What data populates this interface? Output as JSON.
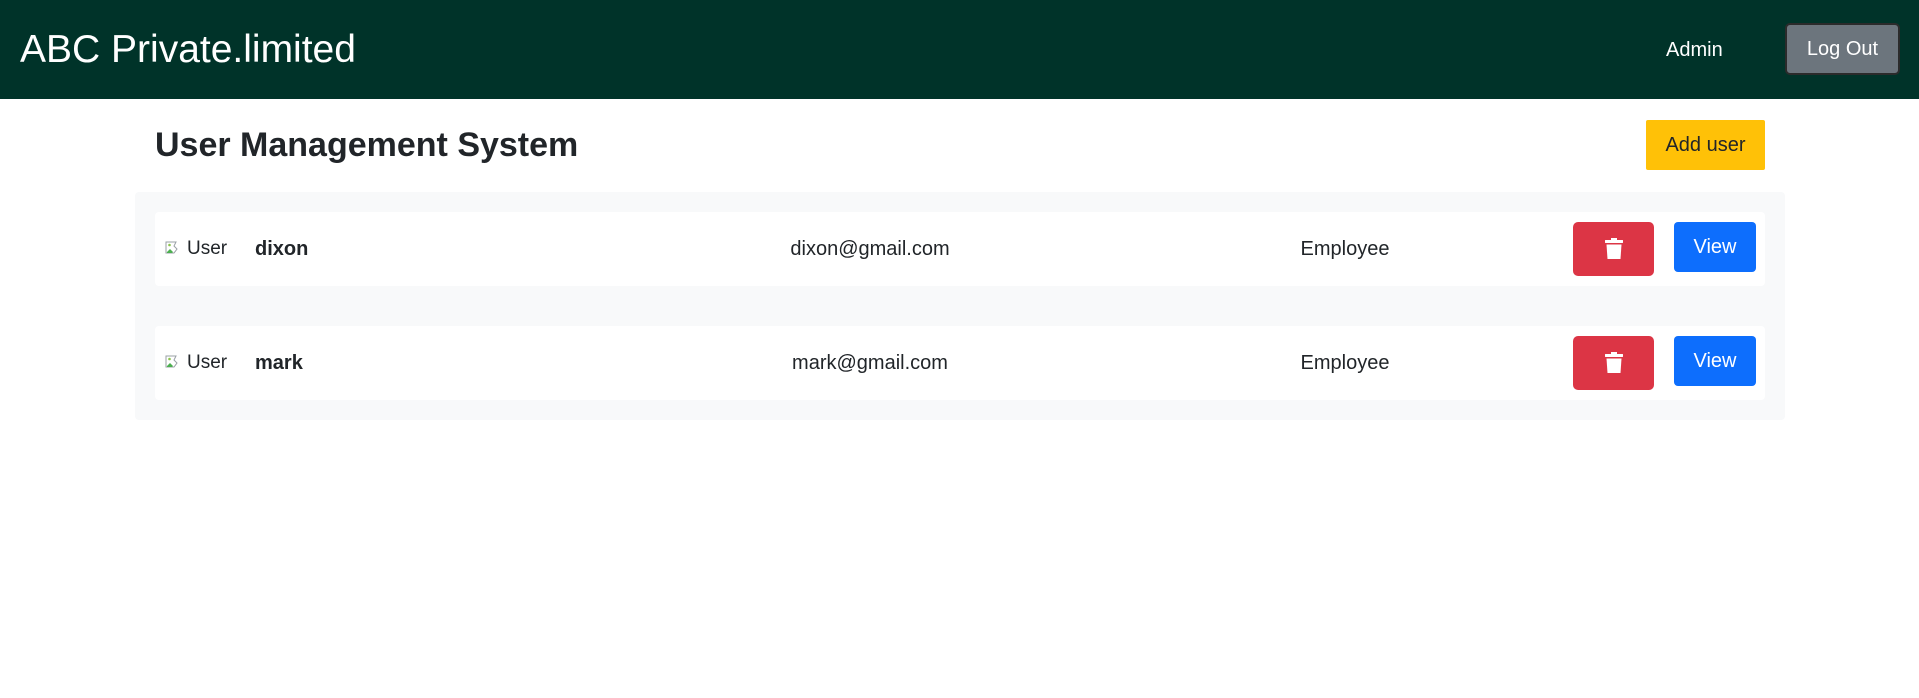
{
  "navbar": {
    "brand": "ABC Private.limited",
    "admin_label": "Admin",
    "logout_label": "Log Out",
    "background_color": "#003329"
  },
  "header": {
    "title": "User Management System",
    "add_user_label": "Add user",
    "add_user_color": "#ffc107"
  },
  "users": [
    {
      "avatar_alt": "User",
      "name": "dixon",
      "email": "dixon@gmail.com",
      "role": "Employee",
      "delete_icon": "trash-icon",
      "view_label": "View"
    },
    {
      "avatar_alt": "User",
      "name": "mark",
      "email": "mark@gmail.com",
      "role": "Employee",
      "delete_icon": "trash-icon",
      "view_label": "View"
    }
  ],
  "colors": {
    "delete": "#dc3545",
    "view": "#0d6efd",
    "logout": "#6c757d"
  }
}
